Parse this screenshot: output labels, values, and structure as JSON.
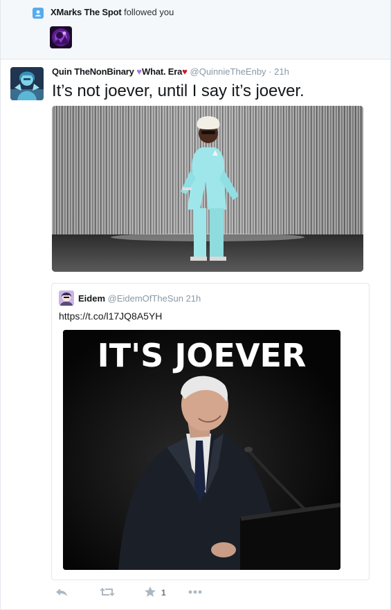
{
  "notification": {
    "user_name": "XMarks The Spot",
    "action_text": " followed you"
  },
  "tweet": {
    "author_name": "Quin TheNonBinary",
    "author_suffix": "What. Era",
    "handle": "@QuinnieTheEnby",
    "time": "· 21h",
    "text": "It’s not joever, until I say it’s joever.",
    "like_count": "1"
  },
  "quoted_tweet": {
    "author_name": "Eidem",
    "handle": "@EidemOfTheSun",
    "time": "21h",
    "text": "https://t.co/l17JQ8A5YH",
    "image_caption": "IT'S JOEVER"
  },
  "colors": {
    "accent": "#55acee",
    "secondary_text": "#8899a6",
    "action_icon": "#aab8c2"
  },
  "icons": [
    "person-follow-icon",
    "purple-heart-icon",
    "red-heart-icon",
    "reply-icon",
    "retweet-icon",
    "like-star-icon",
    "more-icon"
  ]
}
